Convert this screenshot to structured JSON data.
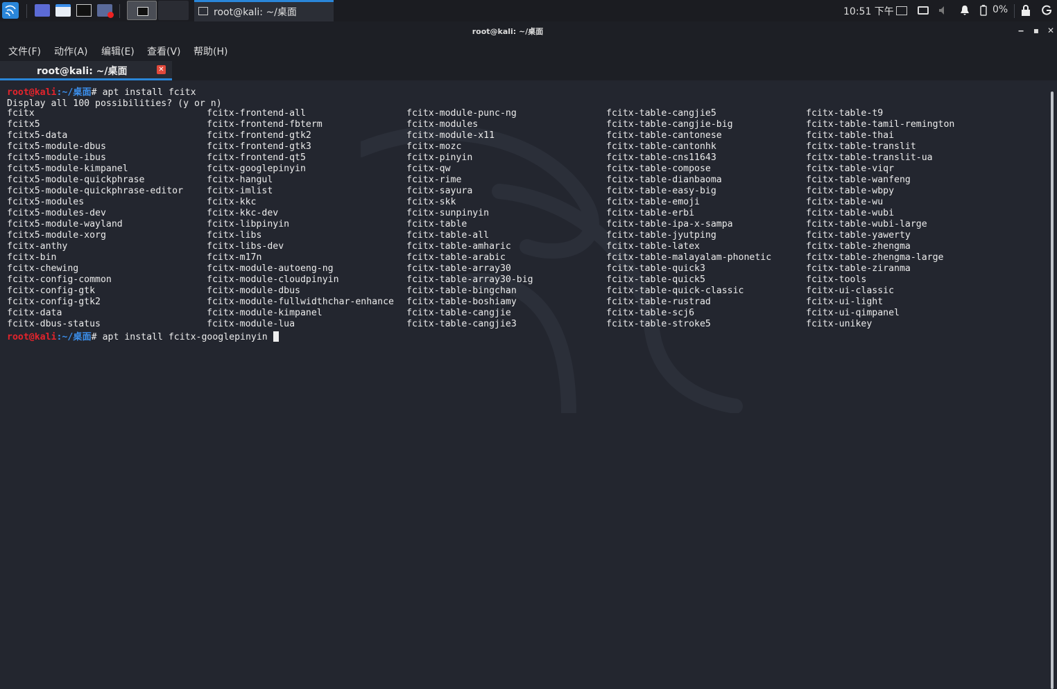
{
  "taskbar": {
    "window_title": "root@kali: ~/桌面",
    "clock": "10:51 下午",
    "battery": "0%"
  },
  "window": {
    "title": "root@kali: ~/桌面",
    "menu": [
      "文件(F)",
      "动作(A)",
      "编辑(E)",
      "查看(V)",
      "帮助(H)"
    ],
    "tab_label": "root@kali: ~/桌面"
  },
  "terminal": {
    "prompt_user": "root@kali",
    "prompt_path": ":~/桌面",
    "prompt_symbol": "# ",
    "command1": "apt install fcitx",
    "question": "Display all 100 possibilities? (y or n)",
    "command2": "apt install fcitx-googlepinyin ",
    "columns": [
      [
        "fcitx",
        "fcitx5",
        "fcitx5-data",
        "fcitx5-module-dbus",
        "fcitx5-module-ibus",
        "fcitx5-module-kimpanel",
        "fcitx5-module-quickphrase",
        "fcitx5-module-quickphrase-editor",
        "fcitx5-modules",
        "fcitx5-modules-dev",
        "fcitx5-module-wayland",
        "fcitx5-module-xorg",
        "fcitx-anthy",
        "fcitx-bin",
        "fcitx-chewing",
        "fcitx-config-common",
        "fcitx-config-gtk",
        "fcitx-config-gtk2",
        "fcitx-data",
        "fcitx-dbus-status"
      ],
      [
        "fcitx-frontend-all",
        "fcitx-frontend-fbterm",
        "fcitx-frontend-gtk2",
        "fcitx-frontend-gtk3",
        "fcitx-frontend-qt5",
        "fcitx-googlepinyin",
        "fcitx-hangul",
        "fcitx-imlist",
        "fcitx-kkc",
        "fcitx-kkc-dev",
        "fcitx-libpinyin",
        "fcitx-libs",
        "fcitx-libs-dev",
        "fcitx-m17n",
        "fcitx-module-autoeng-ng",
        "fcitx-module-cloudpinyin",
        "fcitx-module-dbus",
        "fcitx-module-fullwidthchar-enhance",
        "fcitx-module-kimpanel",
        "fcitx-module-lua"
      ],
      [
        "fcitx-module-punc-ng",
        "fcitx-modules",
        "fcitx-module-x11",
        "fcitx-mozc",
        "fcitx-pinyin",
        "fcitx-qw",
        "fcitx-rime",
        "fcitx-sayura",
        "fcitx-skk",
        "fcitx-sunpinyin",
        "fcitx-table",
        "fcitx-table-all",
        "fcitx-table-amharic",
        "fcitx-table-arabic",
        "fcitx-table-array30",
        "fcitx-table-array30-big",
        "fcitx-table-bingchan",
        "fcitx-table-boshiamy",
        "fcitx-table-cangjie",
        "fcitx-table-cangjie3"
      ],
      [
        "fcitx-table-cangjie5",
        "fcitx-table-cangjie-big",
        "fcitx-table-cantonese",
        "fcitx-table-cantonhk",
        "fcitx-table-cns11643",
        "fcitx-table-compose",
        "fcitx-table-dianbaoma",
        "fcitx-table-easy-big",
        "fcitx-table-emoji",
        "fcitx-table-erbi",
        "fcitx-table-ipa-x-sampa",
        "fcitx-table-jyutping",
        "fcitx-table-latex",
        "fcitx-table-malayalam-phonetic",
        "fcitx-table-quick3",
        "fcitx-table-quick5",
        "fcitx-table-quick-classic",
        "fcitx-table-rustrad",
        "fcitx-table-scj6",
        "fcitx-table-stroke5"
      ],
      [
        "fcitx-table-t9",
        "fcitx-table-tamil-remington",
        "fcitx-table-thai",
        "fcitx-table-translit",
        "fcitx-table-translit-ua",
        "fcitx-table-viqr",
        "fcitx-table-wanfeng",
        "fcitx-table-wbpy",
        "fcitx-table-wu",
        "fcitx-table-wubi",
        "fcitx-table-wubi-large",
        "fcitx-table-yawerty",
        "fcitx-table-zhengma",
        "fcitx-table-zhengma-large",
        "fcitx-table-ziranma",
        "fcitx-tools",
        "fcitx-ui-classic",
        "fcitx-ui-light",
        "fcitx-ui-qimpanel",
        "fcitx-unikey"
      ]
    ]
  }
}
